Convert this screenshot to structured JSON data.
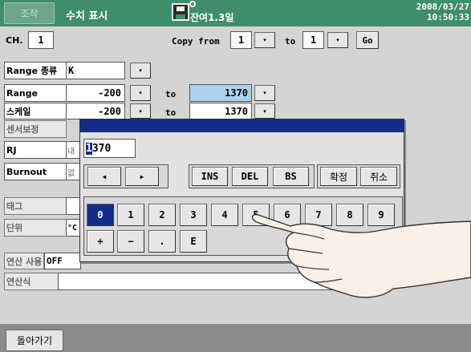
{
  "header": {
    "operation_label": "조작",
    "screen_title": "수치 표시",
    "memory_remaining": "잔여1.3일",
    "date": "2008/03/27",
    "time": "10:50:33"
  },
  "top_row": {
    "ch_label": "CH.",
    "ch_value": "1",
    "copy_from_label": "Copy from",
    "copy_from_value": "1",
    "to_label": "to",
    "to_value": "1",
    "go_label": "Go"
  },
  "settings": {
    "range_type_label": "Range 종류",
    "range_type_value": "K",
    "range_label": "Range",
    "range_min": "-200",
    "range_to": "to",
    "range_max": "1370",
    "scale_label": "스케일",
    "scale_min": "-200",
    "scale_to": "to",
    "scale_max": "1370",
    "sensor_label": "센서보정",
    "rj_label": "RJ",
    "rj_value": "내",
    "burnout_label": "Burnout",
    "burnout_value": "없",
    "tag_label": "태그",
    "unit_label": "단위",
    "unit_value": "°C",
    "calc_use_label": "연산 사용",
    "calc_use_value": "OFF",
    "calc_expr_label": "연산식"
  },
  "keypad": {
    "entry_value": "1370",
    "entry_cursor_char": "1",
    "entry_rest": "370",
    "left_arrow": "◂",
    "right_arrow": "▸",
    "ins": "INS",
    "del": "DEL",
    "bs": "BS",
    "confirm": "확정",
    "cancel": "취소",
    "digits": [
      "0",
      "1",
      "2",
      "3",
      "4",
      "5",
      "6",
      "7",
      "8",
      "9"
    ],
    "plus": "+",
    "minus": "−",
    "dot": ".",
    "exp": "E",
    "selected_key": "0"
  },
  "dropdown_glyph": "▾",
  "footer": {
    "back_label": "돌아가기"
  }
}
